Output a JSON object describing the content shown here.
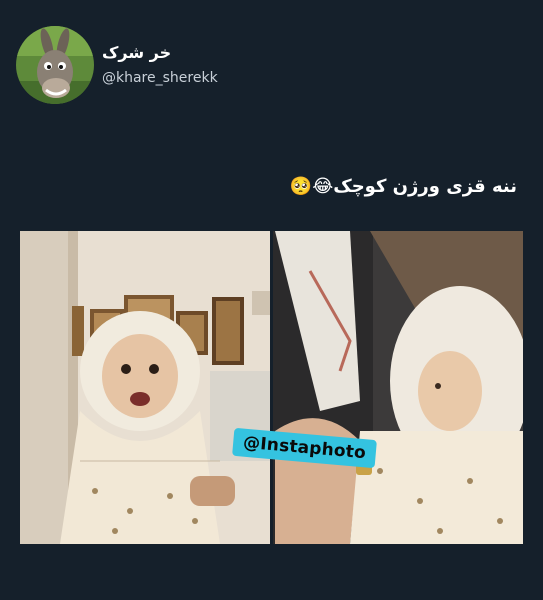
{
  "tweet": {
    "author": {
      "display_name": "خر شرک",
      "handle": "@khare_sherekk",
      "avatar_icon": "donkey-avatar-icon"
    },
    "text": "ننه قزی ورژن کوچک😂🥺",
    "media": {
      "watermark": "@Instaphoto"
    }
  },
  "colors": {
    "background": "#15202b",
    "text_primary": "#ffffff",
    "text_secondary": "#c8d0d8",
    "watermark_bg": "#34c3e0"
  }
}
